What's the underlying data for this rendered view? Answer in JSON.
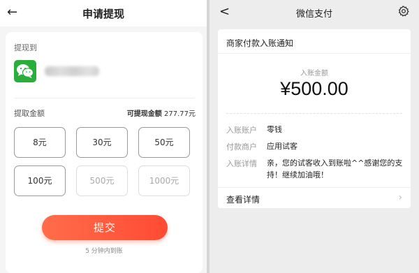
{
  "left": {
    "header": {
      "back_glyph": "←",
      "title": "申请提现"
    },
    "withdraw_to_label": "提现到",
    "account_icon": "wechat-logo",
    "amount_label": "提取金额",
    "available_label": "可提现金额",
    "available_value": "277.77元",
    "amounts": [
      {
        "label": "8元",
        "enabled": true
      },
      {
        "label": "30元",
        "enabled": true
      },
      {
        "label": "50元",
        "enabled": true
      },
      {
        "label": "100元",
        "enabled": true
      },
      {
        "label": "500元",
        "enabled": false
      },
      {
        "label": "1000元",
        "enabled": false
      }
    ],
    "submit_label": "提交",
    "arrival_note": "5 分钟内到账",
    "accent_color": "#ff5a3c"
  },
  "right": {
    "header": {
      "back_glyph": "<",
      "title": "微信支付",
      "settings_icon": "gear-icon"
    },
    "notice_title": "商家付款入账通知",
    "amount_label": "入账金额",
    "amount_value": "¥500.00",
    "rows": [
      {
        "key": "入账账户",
        "value": "零钱"
      },
      {
        "key": "付款商户",
        "value": "应用试客"
      },
      {
        "key": "入账详情",
        "value": "亲，您的试客收入到账啦^^感谢您的支持！继续加油哦！"
      }
    ],
    "detail_link": "查看详情",
    "chevron_glyph": "›"
  }
}
